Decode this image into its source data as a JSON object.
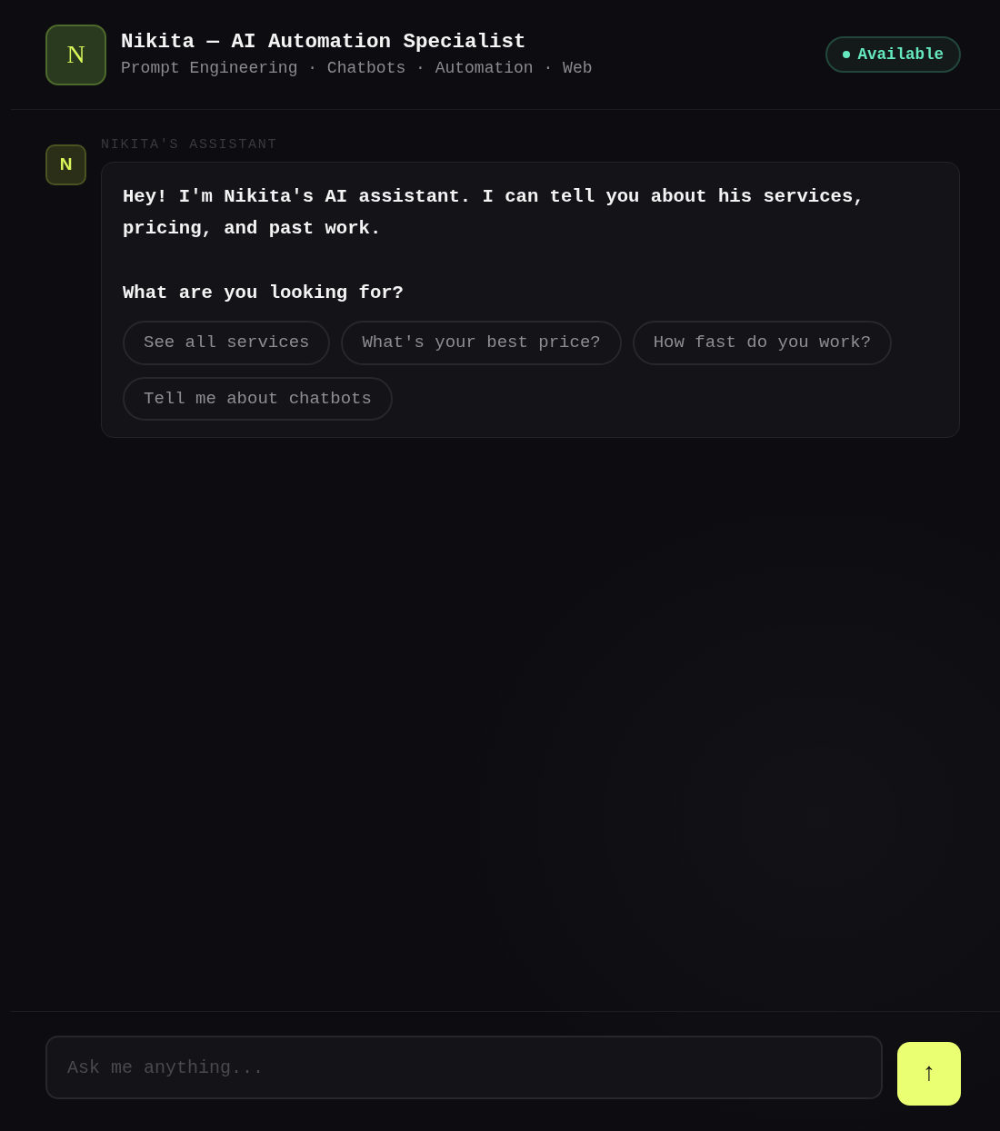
{
  "header": {
    "avatar": "N",
    "title": "Nikita — AI Automation Specialist",
    "subtitle": "Prompt Engineering · Chatbots · Automation · Web",
    "status": {
      "label": "Available"
    }
  },
  "messages": [
    {
      "sender": "NIKITA'S ASSISTANT",
      "avatar": "N",
      "paragraphs": [
        "Hey! I'm Nikita's AI assistant. I can tell you about his services, pricing, and past work.",
        "What are you looking for?"
      ],
      "suggestions": [
        "See all services",
        "What's your best price?",
        "How fast do you work?",
        "Tell me about chatbots"
      ]
    }
  ],
  "composer": {
    "placeholder": "Ask me anything...",
    "send_label": "↑"
  }
}
